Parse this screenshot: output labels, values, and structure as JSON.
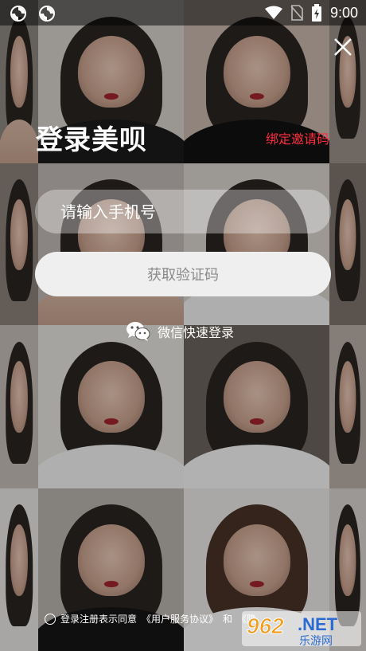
{
  "status_bar": {
    "time": "9:00"
  },
  "login": {
    "title": "登录美呗",
    "invite_label": "绑定邀请码",
    "phone_placeholder": "请输入手机号",
    "get_code_label": "获取验证码",
    "wechat_label": "微信快速登录"
  },
  "agreement": {
    "prefix": "登录注册表示同意",
    "user_agreement": "《用户服务协议》",
    "and": "和",
    "privacy": "《隐"
  },
  "watermark": {
    "number": "962",
    "dot_net": ".NET",
    "cn": "乐游网"
  },
  "colors": {
    "invite": "#ff2c3c",
    "code_button": "#efefef",
    "code_text": "#8a8a8a"
  }
}
